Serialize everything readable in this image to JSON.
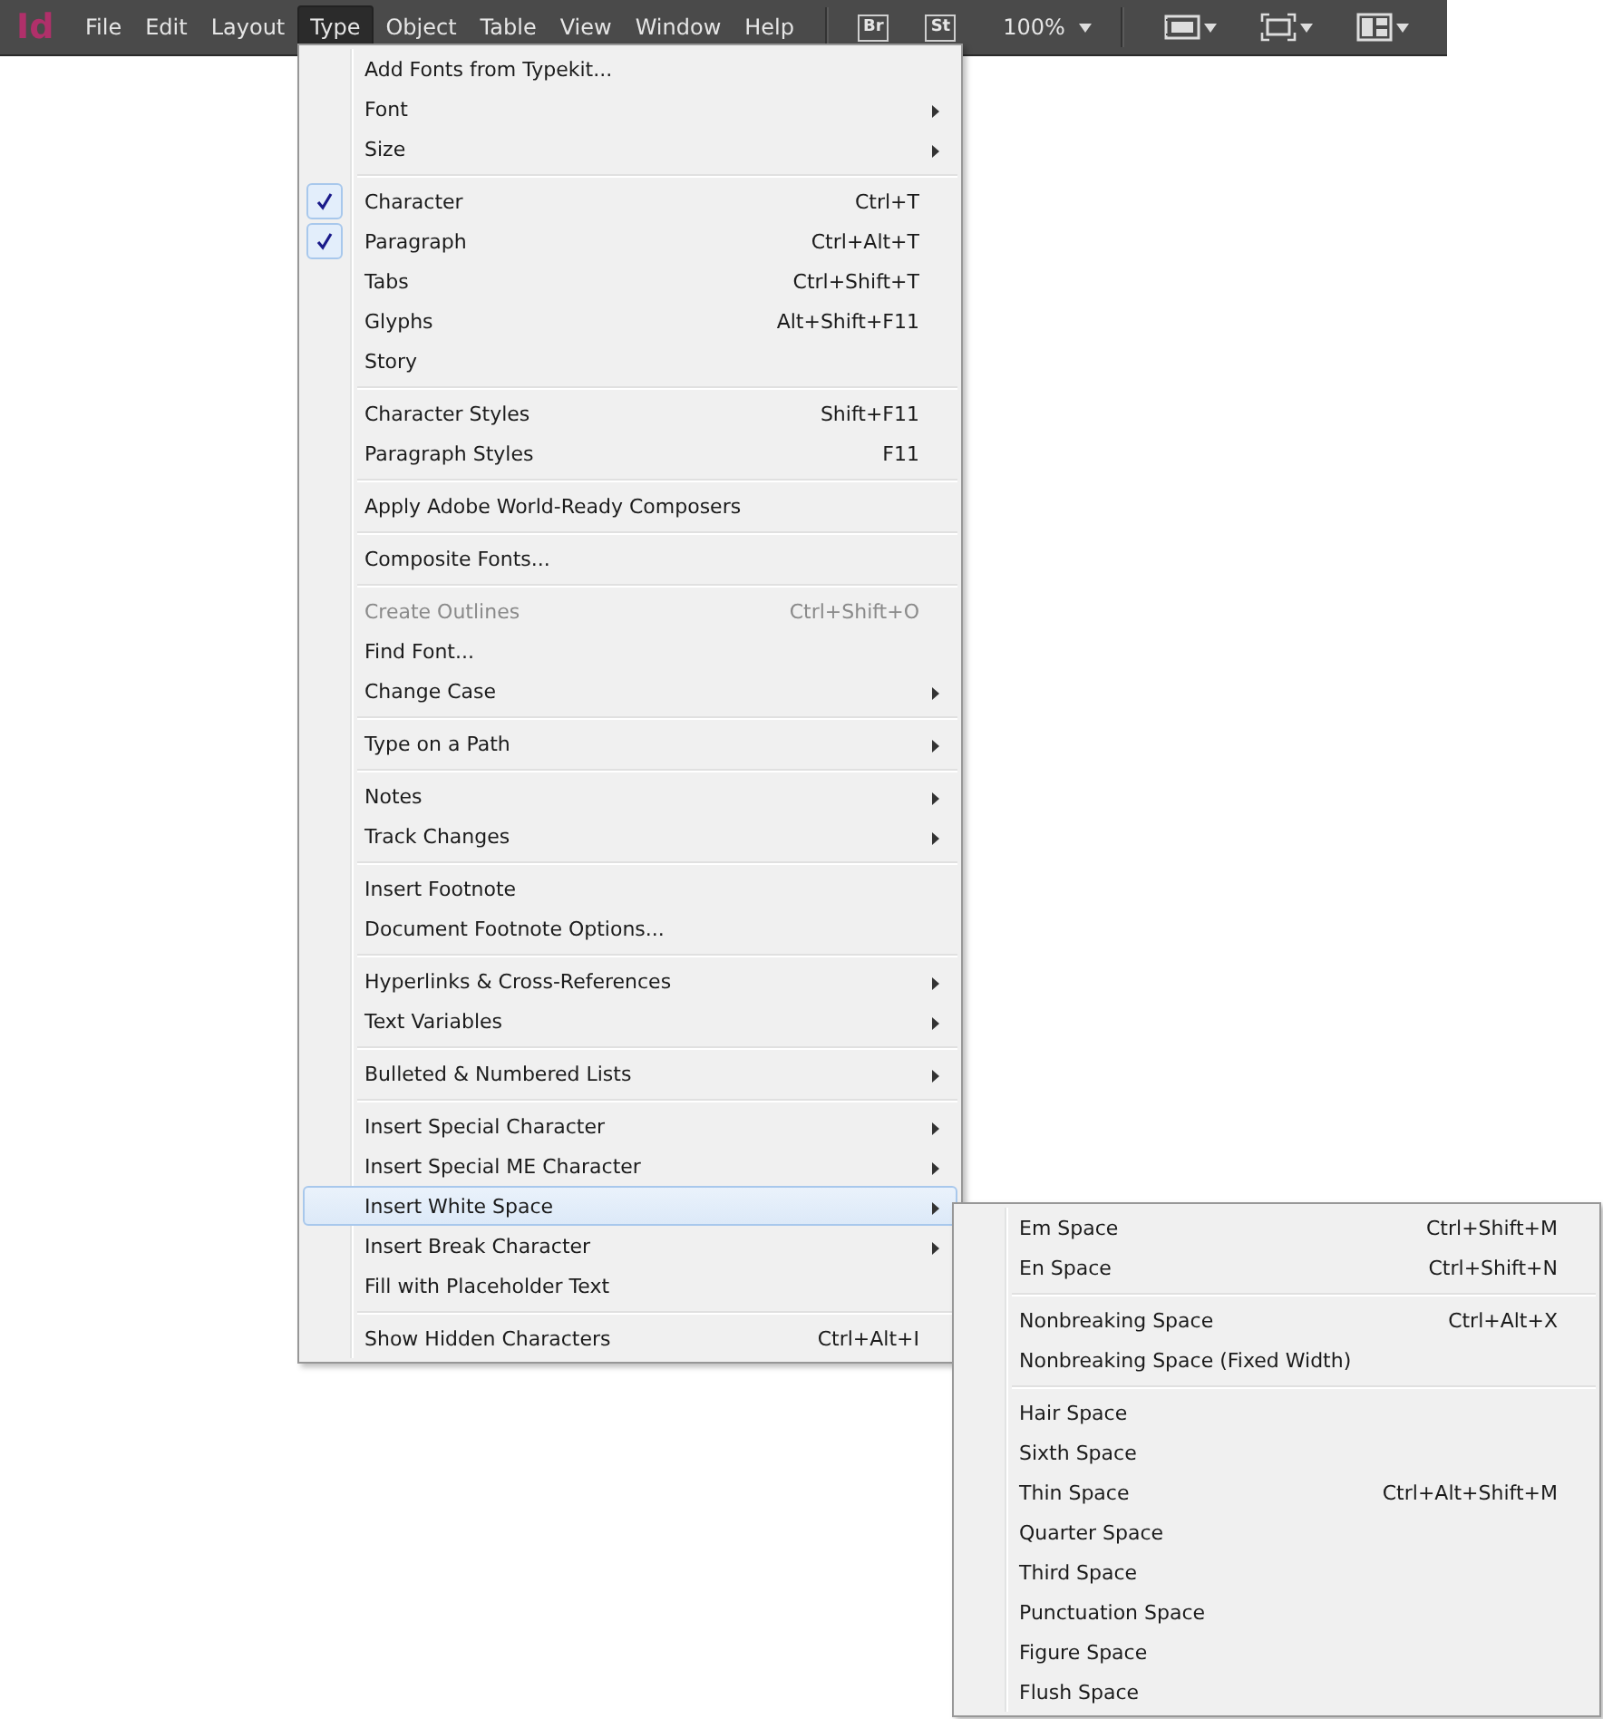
{
  "menubar": {
    "logo": "Id",
    "menus": [
      {
        "label": "File",
        "selected": false
      },
      {
        "label": "Edit",
        "selected": false
      },
      {
        "label": "Layout",
        "selected": false
      },
      {
        "label": "Type",
        "selected": true
      },
      {
        "label": "Object",
        "selected": false
      },
      {
        "label": "Table",
        "selected": false
      },
      {
        "label": "View",
        "selected": false
      },
      {
        "label": "Window",
        "selected": false
      },
      {
        "label": "Help",
        "selected": false
      }
    ],
    "app_buttons": [
      "Br",
      "St"
    ],
    "zoom": "100%"
  },
  "menu": {
    "groups": [
      [
        {
          "label": "Add Fonts from Typekit..."
        },
        {
          "label": "Font",
          "submenu": true
        },
        {
          "label": "Size",
          "submenu": true
        }
      ],
      [
        {
          "label": "Character",
          "shortcut": "Ctrl+T",
          "checked": true
        },
        {
          "label": "Paragraph",
          "shortcut": "Ctrl+Alt+T",
          "checked": true
        },
        {
          "label": "Tabs",
          "shortcut": "Ctrl+Shift+T",
          "checked": false
        },
        {
          "label": "Glyphs",
          "shortcut": "Alt+Shift+F11",
          "checked": false
        },
        {
          "label": "Story",
          "checked": false
        }
      ],
      [
        {
          "label": "Character Styles",
          "shortcut": "Shift+F11"
        },
        {
          "label": "Paragraph Styles",
          "shortcut": "F11"
        }
      ],
      [
        {
          "label": "Apply Adobe World-Ready Composers"
        }
      ],
      [
        {
          "label": "Composite Fonts..."
        }
      ],
      [
        {
          "label": "Create Outlines",
          "shortcut": "Ctrl+Shift+O",
          "disabled": true
        },
        {
          "label": "Find Font..."
        },
        {
          "label": "Change Case",
          "submenu": true
        }
      ],
      [
        {
          "label": "Type on a Path",
          "submenu": true
        }
      ],
      [
        {
          "label": "Notes",
          "submenu": true
        },
        {
          "label": "Track Changes",
          "submenu": true
        }
      ],
      [
        {
          "label": "Insert Footnote"
        },
        {
          "label": "Document Footnote Options..."
        }
      ],
      [
        {
          "label": "Hyperlinks & Cross-References",
          "submenu": true
        },
        {
          "label": "Text Variables",
          "submenu": true
        }
      ],
      [
        {
          "label": "Bulleted & Numbered Lists",
          "submenu": true
        }
      ],
      [
        {
          "label": "Insert Special Character",
          "submenu": true,
          "selected": false
        },
        {
          "label": "Insert Special ME Character",
          "submenu": true,
          "selected": false
        },
        {
          "label": "Insert White Space",
          "submenu": true,
          "selected": true
        },
        {
          "label": "Insert Break Character",
          "submenu": true,
          "selected": false
        },
        {
          "label": "Fill with Placeholder Text",
          "selected": false
        }
      ],
      [
        {
          "label": "Show Hidden Characters",
          "shortcut": "Ctrl+Alt+I"
        }
      ]
    ]
  },
  "submenu": {
    "groups": [
      [
        {
          "label": "Em Space",
          "shortcut": "Ctrl+Shift+M"
        },
        {
          "label": "En Space",
          "shortcut": "Ctrl+Shift+N"
        }
      ],
      [
        {
          "label": "Nonbreaking Space",
          "shortcut": "Ctrl+Alt+X"
        },
        {
          "label": "Nonbreaking Space (Fixed Width)"
        }
      ],
      [
        {
          "label": "Hair Space"
        },
        {
          "label": "Sixth Space"
        },
        {
          "label": "Thin Space",
          "shortcut": "Ctrl+Alt+Shift+M"
        },
        {
          "label": "Quarter Space"
        },
        {
          "label": "Third Space"
        },
        {
          "label": "Punctuation Space"
        },
        {
          "label": "Figure Space"
        },
        {
          "label": "Flush Space"
        }
      ]
    ]
  }
}
